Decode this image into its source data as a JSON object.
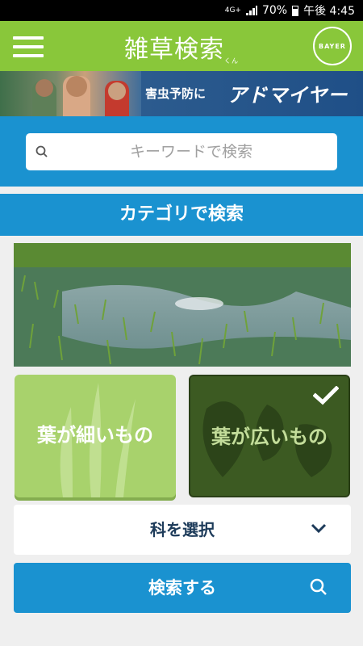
{
  "status_bar": {
    "network": "4G+",
    "volte": "VoLTE",
    "battery": "70%",
    "time": "午後 4:45"
  },
  "app_bar": {
    "title": "雑草検索",
    "title_suffix": "くん",
    "logo_text_h": "BAYER",
    "logo_text_v": [
      "B",
      "A",
      "",
      "E",
      "R"
    ]
  },
  "banner": {
    "text": "害虫予防に",
    "brand": "アドマイヤー"
  },
  "search": {
    "placeholder": "キーワードで検索"
  },
  "category": {
    "header": "カテゴリで検索",
    "narrow_leaf_label": "葉が細いもの",
    "wide_leaf_label": "葉が広いもの",
    "selected": "wide"
  },
  "family_select": {
    "label": "科を選択"
  },
  "search_button": {
    "label": "検索する"
  },
  "colors": {
    "app_bar": "#89c73a",
    "primary_blue": "#1a92d0",
    "narrow_leaf_bg": "#a8d26c",
    "wide_leaf_bg": "#3c5a22"
  },
  "icons": {
    "menu": "hamburger-icon",
    "search": "search-icon",
    "check": "check-icon",
    "chevron": "chevron-down-icon"
  }
}
